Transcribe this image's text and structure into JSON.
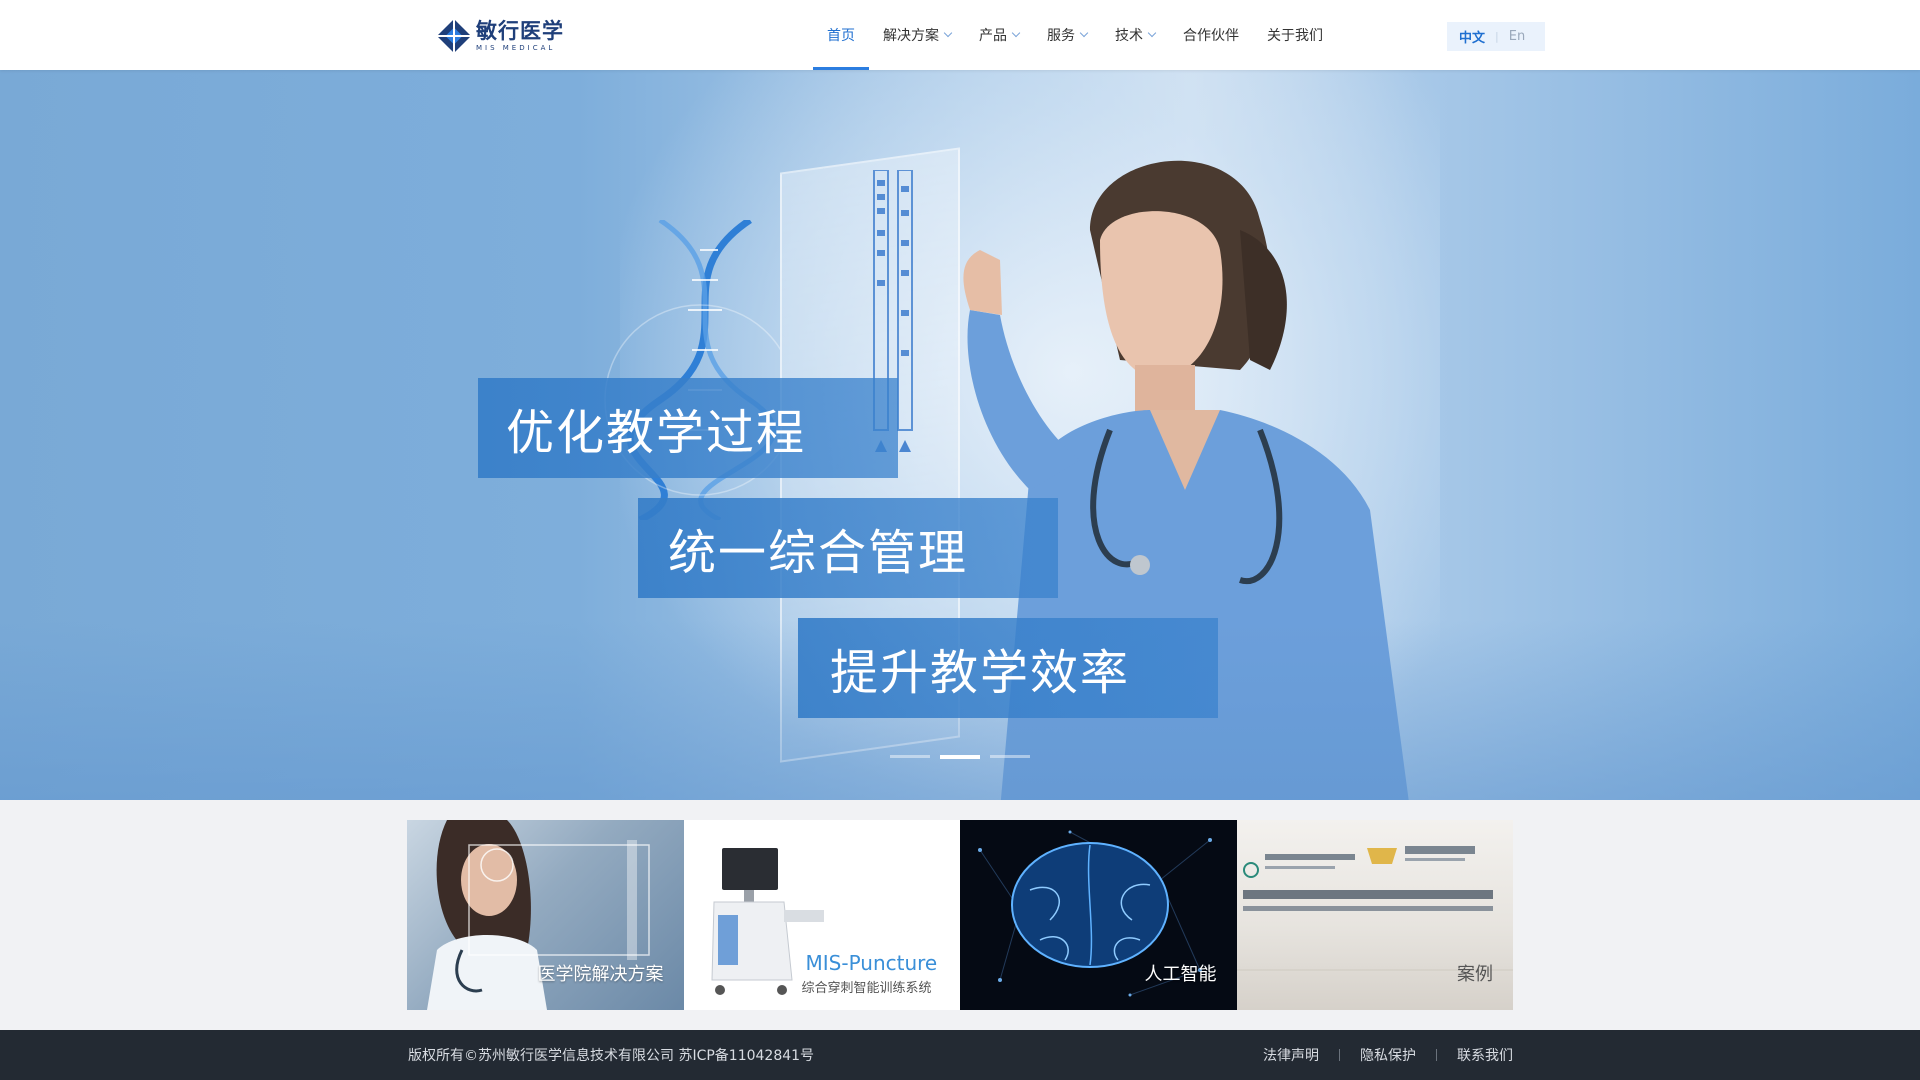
{
  "brand": {
    "name_cn": "敏行医学",
    "name_en": "MIS MEDICAL"
  },
  "nav": {
    "items": [
      {
        "label": "首页",
        "active": true,
        "has_dropdown": false
      },
      {
        "label": "解决方案",
        "active": false,
        "has_dropdown": true
      },
      {
        "label": "产品",
        "active": false,
        "has_dropdown": true
      },
      {
        "label": "服务",
        "active": false,
        "has_dropdown": true
      },
      {
        "label": "技术",
        "active": false,
        "has_dropdown": true
      },
      {
        "label": "合作伙伴",
        "active": false,
        "has_dropdown": false
      },
      {
        "label": "关于我们",
        "active": false,
        "has_dropdown": false
      }
    ]
  },
  "lang": {
    "cn": "中文",
    "en": "En",
    "separator": "|"
  },
  "hero": {
    "slogans": [
      "优化教学过程",
      "统一综合管理",
      "提升教学效率"
    ],
    "slide_count": 3,
    "active_slide": 2
  },
  "cards": [
    {
      "label": "医学院解决方案"
    },
    {
      "title": "MIS-Puncture",
      "subtitle": "综合穿刺智能训练系统"
    },
    {
      "label": "人工智能"
    },
    {
      "label": "案例"
    }
  ],
  "footer": {
    "copyright": "版权所有©苏州敏行医学信息技术有限公司  苏ICP备11042841号",
    "links": [
      "法律声明",
      "隐私保护",
      "联系我们"
    ]
  },
  "colors": {
    "accent": "#1f6fd0",
    "brand_navy": "#1f3f7a",
    "slogan_bg": "#357dc8",
    "footer_bg": "#232a33"
  }
}
